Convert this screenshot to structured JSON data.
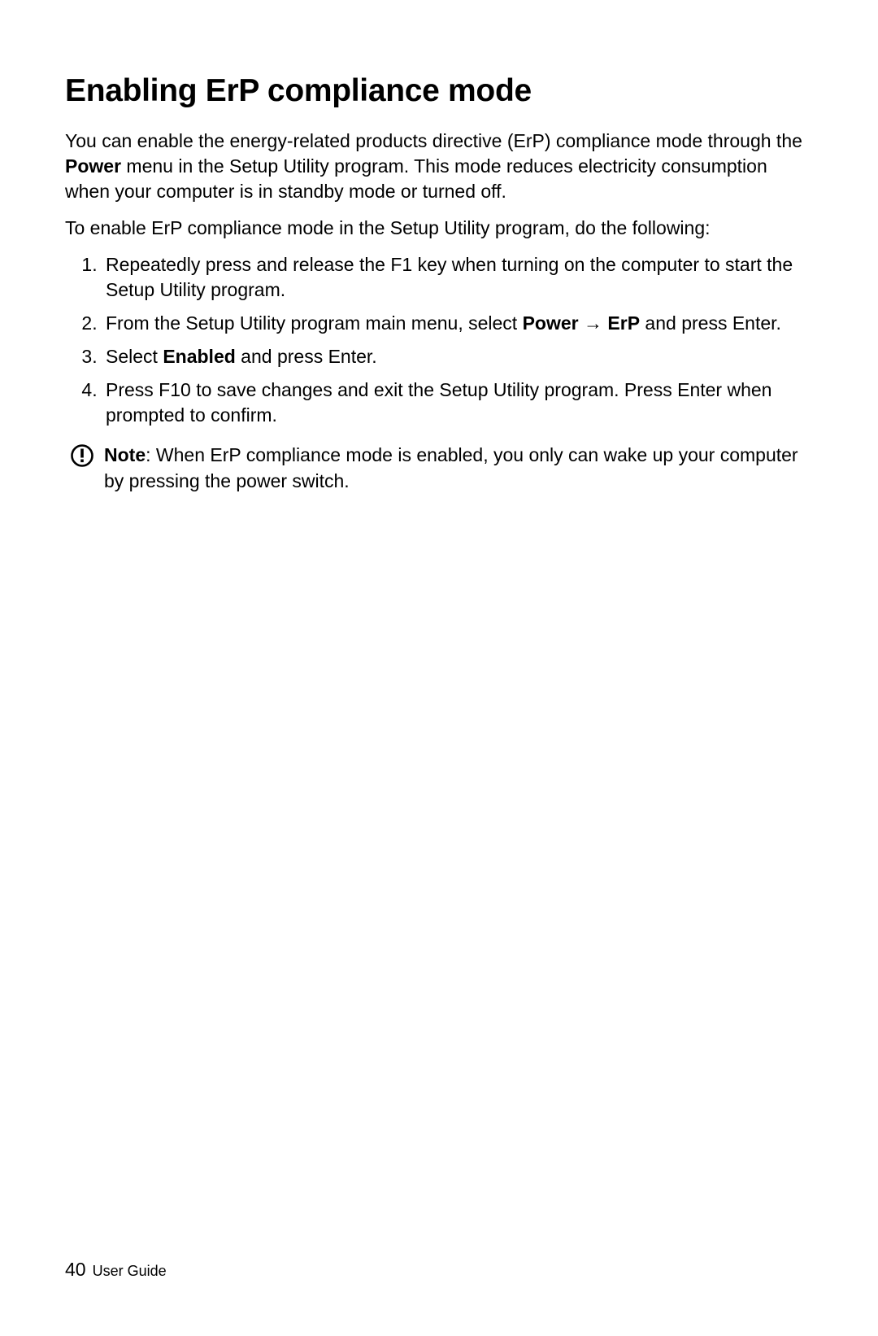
{
  "title": "Enabling ErP compliance mode",
  "intro_p1_a": "You can enable the energy-related products directive (ErP) compliance mode through the ",
  "intro_p1_bold": "Power",
  "intro_p1_b": " menu in the Setup Utility program. This mode reduces electricity consumption when your computer is in standby mode or turned off.",
  "intro_p2": "To enable ErP compliance mode in the Setup Utility program, do the following:",
  "steps": {
    "s1": "Repeatedly press and release the F1 key when turning on the computer to start the Setup Utility program.",
    "s2_a": "From the Setup Utility program main menu, select ",
    "s2_b1": "Power",
    "s2_arrow": " → ",
    "s2_b2": "ErP",
    "s2_c": " and press Enter.",
    "s3_a": "Select ",
    "s3_b": "Enabled",
    "s3_c": " and press Enter.",
    "s4": "Press F10 to save changes and exit the Setup Utility program. Press Enter when prompted to confirm."
  },
  "note_label": "Note",
  "note_text": ": When ErP compliance mode is enabled, you only can wake up your computer by pressing the power switch.",
  "footer_page": "40",
  "footer_label": "User Guide"
}
